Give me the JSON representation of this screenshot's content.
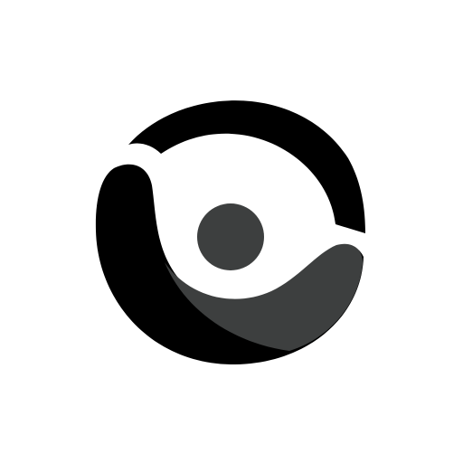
{
  "logo": {
    "icon": "abstract-person-circle-icon",
    "colors": {
      "background": "#ffffff",
      "primary": "#000000",
      "secondary": "#3d3f3f"
    }
  }
}
